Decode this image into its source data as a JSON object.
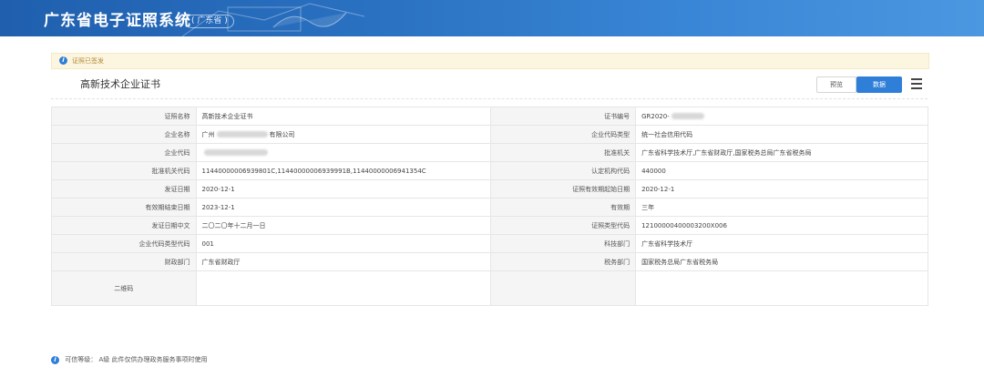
{
  "header": {
    "title": "广东省电子证照系统",
    "region": "( 广东省 )"
  },
  "notice": {
    "text": "证照已签发"
  },
  "certificate": {
    "title": "高新技术企业证书"
  },
  "toolbar": {
    "preview_label": "预览",
    "data_label": "数据",
    "menu_icon": "hamburger-menu-icon"
  },
  "fields": [
    {
      "l1": "证照名称",
      "v1": "高新技术企业证书",
      "l2": "证书编号",
      "v2": "GR2020-"
    },
    {
      "l1": "企业名称",
      "v1": "广州",
      "v1b": "有限公司",
      "l2": "企业代码类型",
      "v2": "统一社会信用代码"
    },
    {
      "l1": "企业代码",
      "v1": "",
      "l2": "批准机关",
      "v2": "广东省科学技术厅,广东省财政厅,国家税务总局广东省税务局"
    },
    {
      "l1": "批准机关代码",
      "v1": "11440000006939801C,11440000006939991B,11440000006941354C",
      "l2": "认定机构代码",
      "v2": "440000"
    },
    {
      "l1": "发证日期",
      "v1": "2020-12-1",
      "l2": "证照有效期起始日期",
      "v2": "2020-12-1"
    },
    {
      "l1": "有效期结束日期",
      "v1": "2023-12-1",
      "l2": "有效期",
      "v2": "三年"
    },
    {
      "l1": "发证日期中文",
      "v1": "二〇二〇年十二月一日",
      "l2": "证照类型代码",
      "v2": "12100000400003200X006"
    },
    {
      "l1": "企业代码类型代码",
      "v1": "001",
      "l2": "科技部门",
      "v2": "广东省科学技术厅"
    },
    {
      "l1": "财政部门",
      "v1": "广东省财政厅",
      "l2": "税务部门",
      "v2": "国家税务总局广东省税务局"
    },
    {
      "l1": "二维码",
      "v1": "",
      "l2": "",
      "v2": ""
    }
  ],
  "footer": {
    "text": "可信等级： A级 此件仅供办理政务服务事项时使用"
  }
}
